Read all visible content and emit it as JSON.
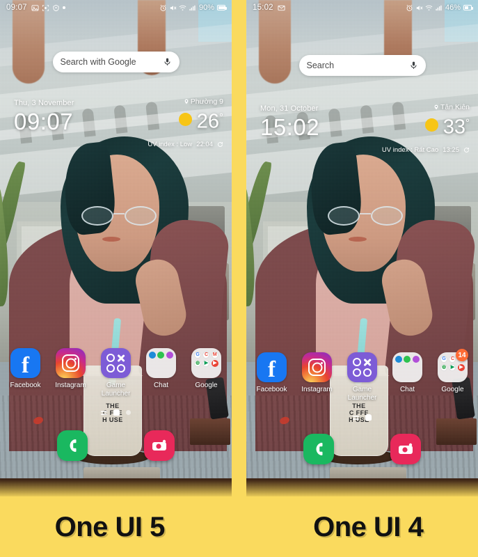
{
  "page": {
    "background_color": "#fada5e",
    "divider_color": "#fada5e"
  },
  "captions": {
    "left": "One UI 5",
    "right": "One UI 4"
  },
  "phones": [
    {
      "id": "one-ui-5",
      "statusbar": {
        "clock": "09:07",
        "left_icons": [
          "gallery-icon",
          "screenshot-icon",
          "security-icon",
          "dot-indicator"
        ],
        "right_icons": [
          "alarm-icon",
          "mute-icon",
          "wifi-icon",
          "signal-icon"
        ],
        "battery_text": "90%",
        "battery_level": 90
      },
      "search": {
        "text": "Search with Google",
        "mic_icon": "microphone-icon"
      },
      "clock_widget": {
        "date": "Thu, 3 November",
        "time": "09:07"
      },
      "weather": {
        "location": "Phường 9",
        "location_pin_icon": "location-pin-icon",
        "condition_icon": "sun-icon",
        "temperature": "26",
        "degree": "°",
        "uv_index": "UV index : Low",
        "updated": "22:04",
        "refresh_icon": "refresh-icon"
      },
      "apps": [
        {
          "label": "Facebook",
          "icon": "facebook-icon"
        },
        {
          "label": "Instagram",
          "icon": "instagram-icon"
        },
        {
          "label": "Game Launcher",
          "icon": "game-launcher-icon"
        },
        {
          "label": "Chat",
          "icon": "chat-folder-icon",
          "badge": null
        },
        {
          "label": "Google",
          "icon": "google-folder-icon",
          "badge": null
        }
      ],
      "page_indicators": [
        "lines",
        "home",
        "dot"
      ],
      "dock": [
        {
          "label": "Phone",
          "icon": "phone-icon"
        },
        {
          "label": "Camera",
          "icon": "camera-icon"
        }
      ]
    },
    {
      "id": "one-ui-4",
      "statusbar": {
        "clock": "15:02",
        "left_icons": [
          "gmail-icon"
        ],
        "right_icons": [
          "alarm-icon",
          "mute-icon",
          "wifi-icon",
          "signal-icon"
        ],
        "battery_text": "46%",
        "battery_level": 46
      },
      "search": {
        "text": "Search",
        "mic_icon": "microphone-icon"
      },
      "clock_widget": {
        "date": "Mon, 31 October",
        "time": "15:02"
      },
      "weather": {
        "location": "Tân Kiên",
        "location_pin_icon": "location-pin-icon",
        "condition_icon": "sun-icon",
        "temperature": "33",
        "degree": "°",
        "uv_index": "UV index : Rất Cao",
        "updated": "13:25",
        "refresh_icon": "refresh-icon"
      },
      "apps": [
        {
          "label": "Facebook",
          "icon": "facebook-icon"
        },
        {
          "label": "Instagram",
          "icon": "instagram-icon"
        },
        {
          "label": "Game Launcher",
          "icon": "game-launcher-icon"
        },
        {
          "label": "Chat",
          "icon": "chat-folder-icon",
          "badge": null
        },
        {
          "label": "Google",
          "icon": "google-folder-icon",
          "badge": "14"
        }
      ],
      "page_indicators": [
        "lines",
        "home"
      ],
      "dock": [
        {
          "label": "Phone",
          "icon": "phone-icon"
        },
        {
          "label": "Camera",
          "icon": "camera-icon"
        }
      ]
    }
  ],
  "cup": {
    "brand_line1": "THE",
    "brand_line2": "C FFE",
    "brand_line3": "H USE"
  }
}
